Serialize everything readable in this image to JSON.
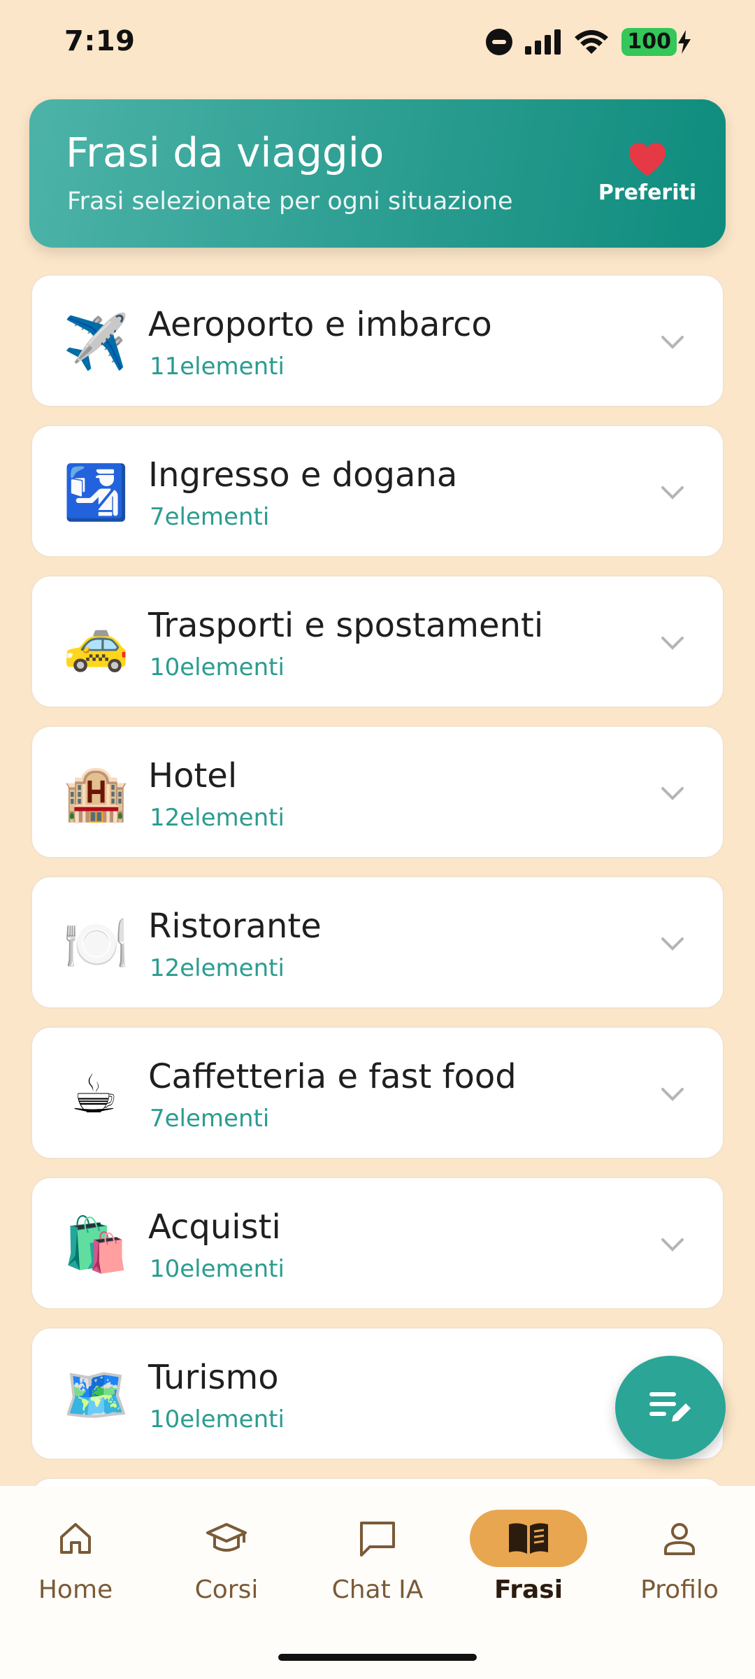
{
  "status_bar": {
    "time": "7:19",
    "battery": "100"
  },
  "header": {
    "title": "Frasi da viaggio",
    "subtitle": "Frasi selezionate per ogni situazione",
    "favorites_label": "Preferiti"
  },
  "categories": [
    {
      "icon": "✈️",
      "icon_name": "airplane-departure-icon",
      "title": "Aeroporto e imbarco",
      "count": "11elementi"
    },
    {
      "icon": "🛂",
      "icon_name": "passport-control-icon",
      "title": "Ingresso e dogana",
      "count": "7elementi"
    },
    {
      "icon": "🚕",
      "icon_name": "taxi-icon",
      "title": "Trasporti e spostamenti",
      "count": "10elementi"
    },
    {
      "icon": "🏨",
      "icon_name": "hotel-icon",
      "title": "Hotel",
      "count": "12elementi"
    },
    {
      "icon": "🍽️",
      "icon_name": "plate-cutlery-icon",
      "title": "Ristorante",
      "count": "12elementi"
    },
    {
      "icon": "☕",
      "icon_name": "coffee-cup-icon",
      "title": "Caffetteria e fast food",
      "count": "7elementi"
    },
    {
      "icon": "🛍️",
      "icon_name": "shopping-bags-icon",
      "title": "Acquisti",
      "count": "10elementi"
    },
    {
      "icon": "🗺️",
      "icon_name": "world-map-icon",
      "title": "Turismo",
      "count": "10elementi"
    }
  ],
  "nav": {
    "items": [
      {
        "label": "Home",
        "icon_name": "home-icon",
        "active": false
      },
      {
        "label": "Corsi",
        "icon_name": "graduation-cap-icon",
        "active": false
      },
      {
        "label": "Chat IA",
        "icon_name": "chat-bubble-icon",
        "active": false
      },
      {
        "label": "Frasi",
        "icon_name": "open-book-icon",
        "active": true
      },
      {
        "label": "Profilo",
        "icon_name": "person-icon",
        "active": false
      }
    ]
  },
  "colors": {
    "background": "#FCE6C9",
    "header_start": "#4DB3A8",
    "header_end": "#0E8C7D",
    "accent_teal": "#2A9C90",
    "nav_active": "#E8A651",
    "heart": "#E63946"
  }
}
